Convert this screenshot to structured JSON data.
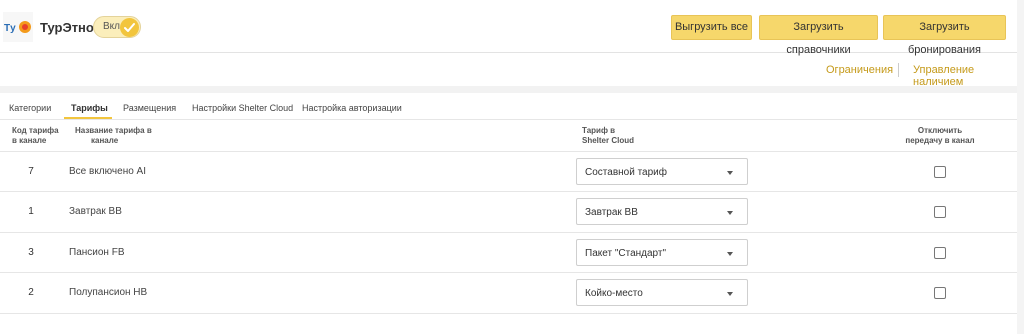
{
  "header": {
    "app_title": "ТурЭтно",
    "logo_text": "Tур",
    "toggle_label": "Вкл.",
    "buttons": {
      "export_all": "Выгрузить все",
      "load_refs": "Загрузить справочники",
      "load_bookings": "Загрузить бронирования"
    },
    "colors": {
      "accent": "#f2c53d",
      "button_bg": "#f6d76b",
      "link": "#c59a1a"
    }
  },
  "sublinks": {
    "limits": "Ограничения",
    "availability": "Управление наличием"
  },
  "tabs": [
    {
      "label": "Категории",
      "active": false
    },
    {
      "label": "Тарифы",
      "active": true
    },
    {
      "label": "Размещения",
      "active": false
    },
    {
      "label": "Настройки Shelter Cloud",
      "active": false
    },
    {
      "label": "Настройка авторизации",
      "active": false
    }
  ],
  "table": {
    "headers": {
      "code_line1": "Код тарифа",
      "code_line2": "в канале",
      "name_line1": "Название тарифа в",
      "name_line2": "канале",
      "tariff_line1": "Тариф в",
      "tariff_line2": "Shelter Cloud",
      "disable_line1": "Отключить",
      "disable_line2": "передачу в канал"
    },
    "rows": [
      {
        "code": "7",
        "name": "Все включено AI",
        "tariff": "Составной тариф",
        "disabled": false
      },
      {
        "code": "1",
        "name": "Завтрак BB",
        "tariff": "Завтрак BB",
        "disabled": false
      },
      {
        "code": "3",
        "name": "Пансион FB",
        "tariff": "Пакет \"Стандарт\"",
        "disabled": false
      },
      {
        "code": "2",
        "name": "Полупансион HB",
        "tariff": "Койко-место",
        "disabled": false
      }
    ]
  }
}
